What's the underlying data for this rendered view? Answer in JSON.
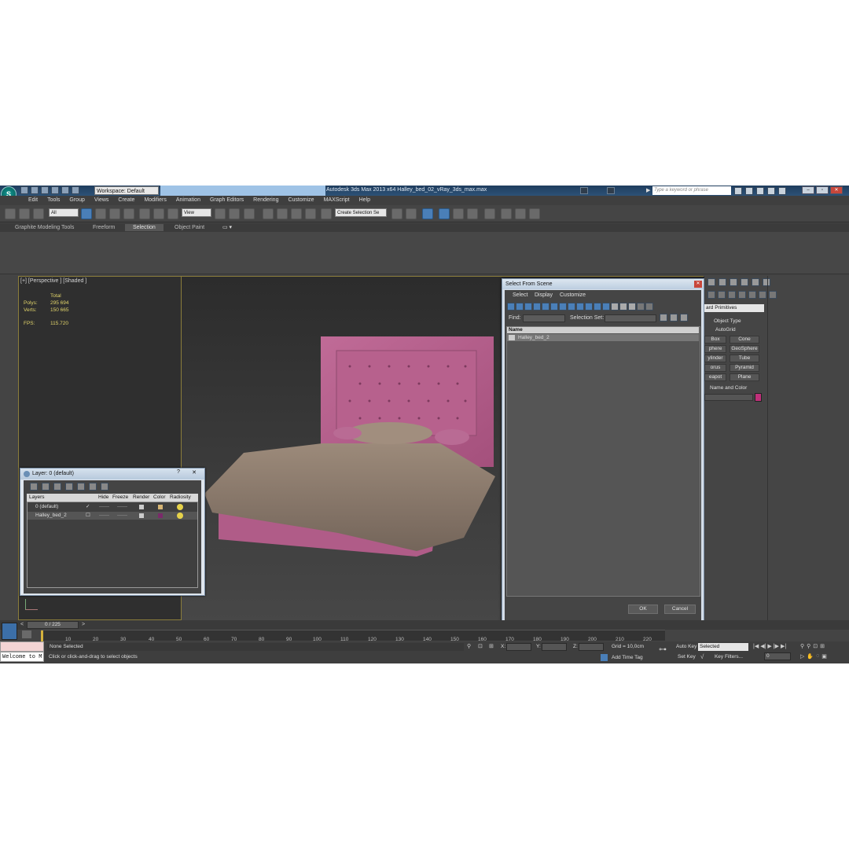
{
  "titlebar": {
    "app_title": "Autodesk 3ds Max  2013 x64     Halley_bed_02_vRay_3ds_max.max",
    "workspace": "Workspace: Default",
    "search_placeholder": "Type a keyword or phrase"
  },
  "menu": [
    "Edit",
    "Tools",
    "Group",
    "Views",
    "Create",
    "Modifiers",
    "Animation",
    "Graph Editors",
    "Rendering",
    "Customize",
    "MAXScript",
    "Help"
  ],
  "toolbar": {
    "filter": "All",
    "ref_coord": "View",
    "named_selection": "Create Selection Se"
  },
  "ribbon_tabs": [
    "Graphite Modeling Tools",
    "Freeform",
    "Selection",
    "Object Paint"
  ],
  "viewport": {
    "label": "[+] [Perspective ] [Shaded ]",
    "stats": {
      "total_label": "Total",
      "polys_label": "Polys:",
      "polys": "295 694",
      "verts_label": "Verts:",
      "verts": "150 665",
      "fps_label": "FPS:",
      "fps": "115.720"
    }
  },
  "layer_dialog": {
    "title": "Layer: 0 (default)",
    "help": "?",
    "close": "✕",
    "columns": [
      "Layers",
      "Hide",
      "Freeze",
      "Render",
      "Color",
      "Radiosity"
    ],
    "rows": [
      {
        "name": "0 (default)",
        "hide": "✓",
        "freeze": "——",
        "render": "——"
      },
      {
        "name": "Halley_bed_2",
        "hide": "☐",
        "freeze": "——",
        "render": "——"
      }
    ]
  },
  "select_from_scene": {
    "title": "Select From Scene",
    "close": "✕",
    "menu": [
      "Select",
      "Display",
      "Customize"
    ],
    "find_label": "Find:",
    "selection_set_label": "Selection Set:",
    "column_name": "Name",
    "items": [
      "Halley_bed_2"
    ],
    "ok": "OK",
    "cancel": "Cancel"
  },
  "command_panel": {
    "category": "ard Primitives",
    "object_type_title": "Object Type",
    "autogrid": "AutoGrid",
    "buttons": [
      "Box",
      "Cone",
      "phere",
      "GeoSphere",
      "ylinder",
      "Tube",
      "orus",
      "Pyramid",
      "eapot",
      "Plane"
    ],
    "name_color_title": "Name and Color",
    "object_color": "#c0307a"
  },
  "timeline": {
    "frame_display": "0 / 225",
    "prev": "<",
    "next": ">",
    "ticks": [
      "10",
      "20",
      "30",
      "40",
      "50",
      "60",
      "70",
      "80",
      "90",
      "100",
      "110",
      "120",
      "130",
      "140",
      "150",
      "160",
      "170",
      "180",
      "190",
      "200",
      "210",
      "220"
    ]
  },
  "status": {
    "maxscript_label": "Welcome to M",
    "selection": "None Selected",
    "prompt": "Click or click-and-drag to select objects",
    "x_label": "X:",
    "y_label": "Y:",
    "z_label": "Z:",
    "grid": "Grid = 10,0cm",
    "add_time_tag": "Add Time Tag",
    "auto_key": "Auto Key",
    "set_key": "Set Key",
    "key_mode": "Selected",
    "key_filters": "Key Filters...",
    "frame_field": "0"
  }
}
